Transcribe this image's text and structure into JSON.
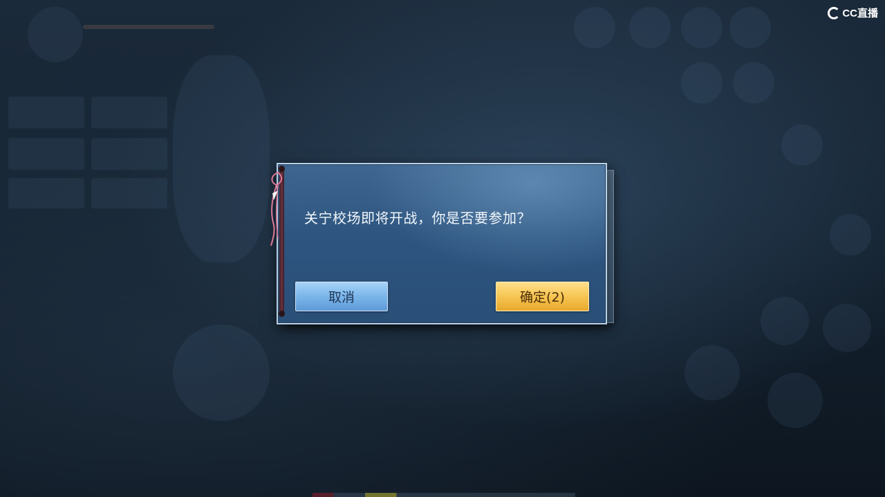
{
  "watermark": {
    "text": "CC直播",
    "logo_icon": "cc-logo-icon"
  },
  "dialog": {
    "message": "关宁校场即将开战，你是否要参加？",
    "cancel_label": "取消",
    "confirm_label": "确定(2)",
    "colors": {
      "panel": "#2d557f",
      "cancel_button": "#7ab5ea",
      "confirm_button": "#f7c553",
      "ribbon": "#e07a9a"
    }
  }
}
